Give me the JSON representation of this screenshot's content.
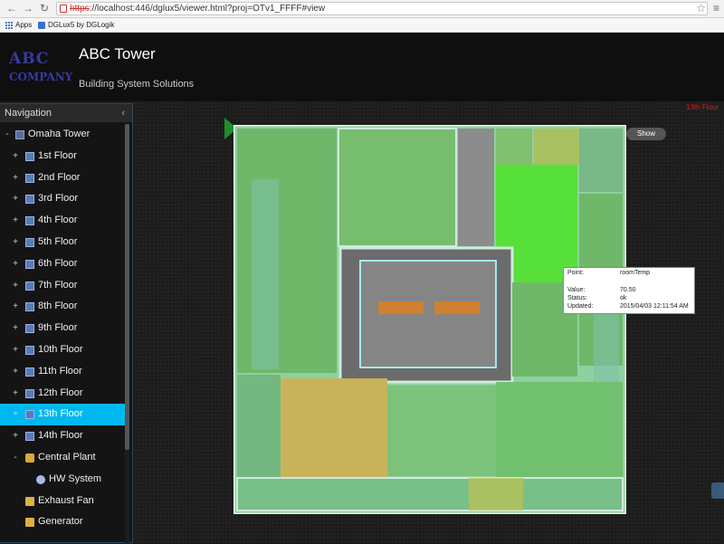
{
  "browser": {
    "url_scheme": "https",
    "url_rest": "://localhost:446/dglux5/viewer.html?proj=OTv1_FFFF#view",
    "bookmarks": [
      {
        "label": "Apps",
        "icon": "apps-grid-icon"
      },
      {
        "label": "DGLux5 by DGLogik",
        "icon": "bookmark-icon"
      }
    ]
  },
  "header": {
    "logo_line1": "ABC",
    "logo_line2": "COMPANY",
    "title": "ABC Tower",
    "subtitle": "Building System Solutions"
  },
  "navigation": {
    "title": "Navigation",
    "root": "Omaha Tower",
    "floors": [
      "1st Floor",
      "2nd Floor",
      "3rd Floor",
      "4th Floor",
      "5th Floor",
      "6th Floor",
      "7th Floor",
      "8th Floor",
      "9th Floor",
      "10th Floor",
      "11th Floor",
      "12th Floor",
      "13th Floor",
      "14th Floor"
    ],
    "selected_floor": "13th Floor",
    "central_plant": "Central Plant",
    "plant_children": [
      "HW System"
    ],
    "others": [
      "Exhaust Fan",
      "Generator"
    ]
  },
  "view": {
    "floor_label": "13th Floor",
    "show_button": "Show"
  },
  "tooltip": {
    "rows": [
      {
        "label": "Point:",
        "value": "roomTemp"
      },
      {
        "label": "Value:",
        "value": "70.50"
      },
      {
        "label": "Status:",
        "value": "ok"
      },
      {
        "label": "Updated:",
        "value": "2015/04/03 12:11:54 AM"
      }
    ]
  },
  "colors": {
    "selected": "#00b8f0",
    "zone_green": "#7dc67a",
    "zone_bright": "#6ee34a",
    "zone_yellow": "#c9b35a",
    "core_gray": "#6b6b6b",
    "alarm_red": "#d02020"
  }
}
